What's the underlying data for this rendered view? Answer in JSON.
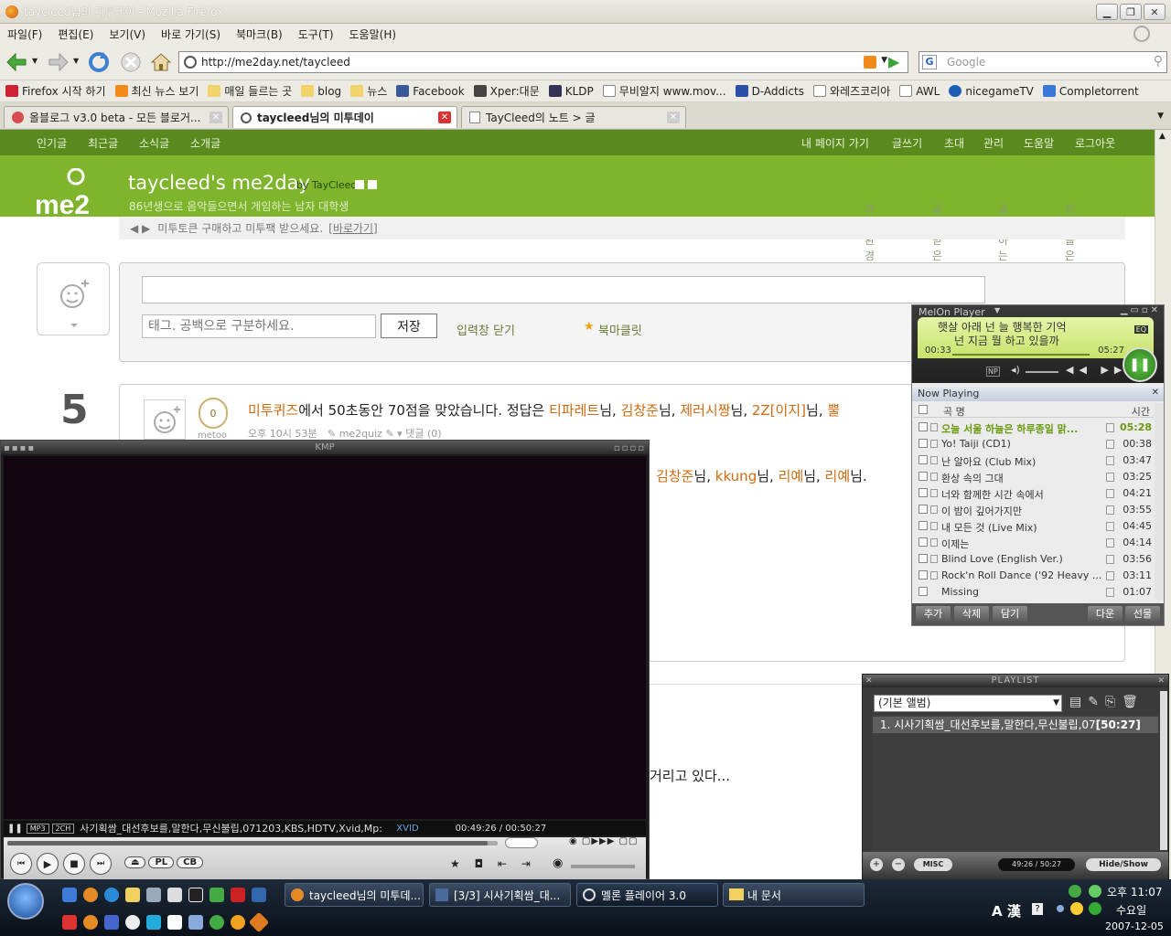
{
  "window": {
    "title": "taycleed님의 미투데이 - Mozilla Firefox"
  },
  "menu": [
    "파일(F)",
    "편집(E)",
    "보기(V)",
    "바로 가기(S)",
    "북마크(B)",
    "도구(T)",
    "도움말(H)"
  ],
  "address": {
    "url": "http://me2day.net/taycleed",
    "search_placeholder": "Google",
    "search_engine": "G"
  },
  "bookmarks": [
    "Firefox 시작 하기",
    "최신 뉴스 보기",
    "매일 들르는 곳",
    "blog",
    "뉴스",
    "Facebook",
    "Xper:대문",
    "KLDP",
    "무비알지 www.mov...",
    "D-Addicts",
    "와레즈코리아",
    "AWL",
    "nicegameTV",
    "Completorrent"
  ],
  "tabs": [
    {
      "label": "올블로그 v3.0 beta - 모든 블로거..."
    },
    {
      "label": "taycleed님의 미투데이"
    },
    {
      "label": "TayCleed의 노트 > 글"
    }
  ],
  "me2": {
    "nav_left": [
      "인기글",
      "최근글",
      "소식글",
      "소개글"
    ],
    "nav_right": [
      "내 페이지 가기",
      "글쓰기",
      "초대",
      "관리",
      "도움말",
      "로그아웃"
    ],
    "title": "taycleed's me2day",
    "by": "by TayCleed",
    "subtitle": "86년생으로 음악들으면서 게임하는 남자 대학생",
    "subnav": [
      "가입환경",
      "공감받은",
      "공감하는",
      "친구들은"
    ],
    "notice": "미투토큰 구매하고 미투팩 받으세요.",
    "notice_link": "[바로가기]",
    "tag_placeholder": "태그. 공백으로 구분하세요.",
    "save_label": "저장",
    "close_input": "입력창 닫기",
    "bookmarklet": "북마클릿",
    "date_day": "5",
    "post1": {
      "quiz": "미투퀴즈",
      "text": "에서 50초동안 70점을 맞았습니다. 정답은",
      "names": [
        "티파레트",
        "김창준",
        "제러시짱",
        "2Z[이지]",
        "뿔"
      ],
      "suffix": "님,",
      "metoo": "0",
      "metoo_label": "metoo",
      "time": "오후 10시 53분",
      "via": "me2quiz",
      "comments": "댓글 (0)"
    },
    "post1_cont": {
      "names": [
        "김창준",
        "kkung",
        "리예",
        "리예"
      ],
      "suffix": "님,",
      "end": "님."
    },
    "post2_tail": "거리고 있다..."
  },
  "kmp": {
    "title": "KMP",
    "badge1": "MP3",
    "badge2": "2CH",
    "file": "사기획쌈_대선후보를,말한다,무신불립,071203,KBS,HDTV,Xvid,Mp:",
    "codec": "XVID",
    "time": "00:49:26 / 00:50:27",
    "btn_pl": "PL",
    "btn_cb": "CB",
    "progress": 0.98
  },
  "melon": {
    "title": "MelOn Player",
    "lyric1": "햇살 아래 넌 늘 행복한 기억",
    "lyric2": "넌 지금 뭘 하고 있을까",
    "elapsed": "00:33",
    "total": "05:27",
    "eq": "EQ",
    "np": "NP",
    "now_playing": "Now Playing",
    "col_song": "곡 명",
    "col_time": "시간",
    "songs": [
      {
        "title": "오늘 서울 하늘은 하루종일 맑...",
        "time": "05:28"
      },
      {
        "title": "Yo! Taiji (CD1)",
        "time": "00:38"
      },
      {
        "title": "난 알아요 (Club Mix)",
        "time": "03:47"
      },
      {
        "title": "환상 속의 그대",
        "time": "03:25"
      },
      {
        "title": "너와 함께한 시간 속에서",
        "time": "04:21"
      },
      {
        "title": "이 밤이 깊어가지만",
        "time": "03:55"
      },
      {
        "title": "내 모든 것 (Live Mix)",
        "time": "04:45"
      },
      {
        "title": "이제는",
        "time": "04:14"
      },
      {
        "title": "Blind Love (English Ver.)",
        "time": "03:56"
      },
      {
        "title": "Rock'n Roll Dance ('92 Heavy ...",
        "time": "03:11"
      },
      {
        "title": "Missing",
        "time": "01:07"
      }
    ],
    "buttons": [
      "추가",
      "삭제",
      "담기"
    ],
    "buttons_right": [
      "다운",
      "선물"
    ]
  },
  "playlist": {
    "title": "PLAYLIST",
    "album": "(기본 앨범)",
    "item": "1. 시사기획쌈_대선후보를,말한다,무신불립,07",
    "item_time": "[50:27]",
    "misc": "MISC",
    "time": "49:26 / 50:27",
    "hideshow": "Hide/Show"
  },
  "taskbar": {
    "tasks": [
      "taycleed님의 미투데...",
      "[3/3] 시사기획쌈_대...",
      "멜론 플레이어 3.0",
      "내 문서"
    ],
    "clock": "오후 11:07",
    "weekday": "수요일",
    "date": "2007-12-05",
    "ime": "A 漢"
  }
}
